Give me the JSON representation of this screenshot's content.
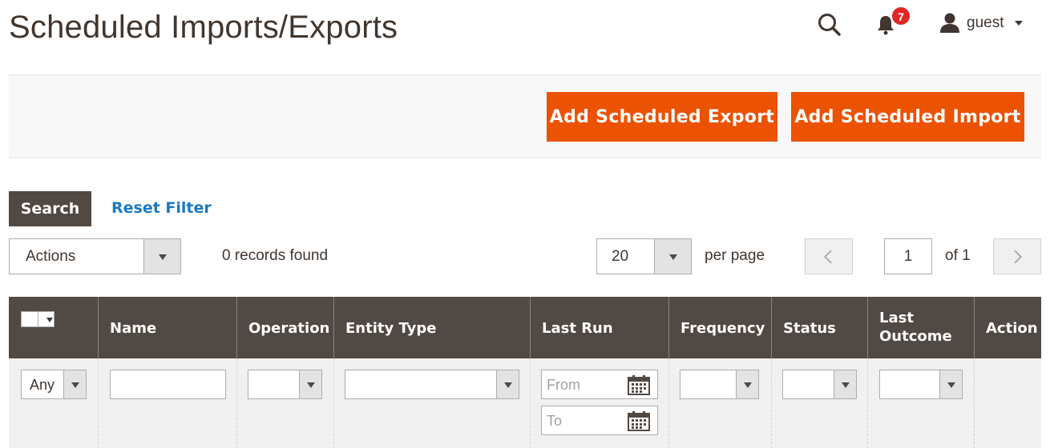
{
  "header": {
    "title": "Scheduled Imports/Exports",
    "notifications_count": "7",
    "user_name": "guest"
  },
  "page_actions": {
    "add_export": "Add Scheduled Export",
    "add_import": "Add Scheduled Import"
  },
  "toolbar": {
    "search_label": "Search",
    "reset_label": "Reset Filter",
    "actions_label": "Actions",
    "records_found": "0 records found",
    "per_page_value": "20",
    "per_page_label": "per page",
    "current_page": "1",
    "of_pages": "of 1"
  },
  "grid": {
    "columns": [
      "Name",
      "Operation",
      "Entity Type",
      "Last Run",
      "Frequency",
      "Status",
      "Last Outcome",
      "Action"
    ],
    "filters": {
      "mass_any": "Any",
      "date_from_placeholder": "From",
      "date_to_placeholder": "To"
    }
  },
  "colors": {
    "accent": "#eb5202",
    "header_bg": "#514943",
    "link": "#1979c3",
    "badge": "#e22626"
  },
  "icons": [
    "search-icon",
    "bell-icon",
    "user-icon",
    "calendar-icon",
    "chevron-left-icon",
    "chevron-right-icon"
  ]
}
